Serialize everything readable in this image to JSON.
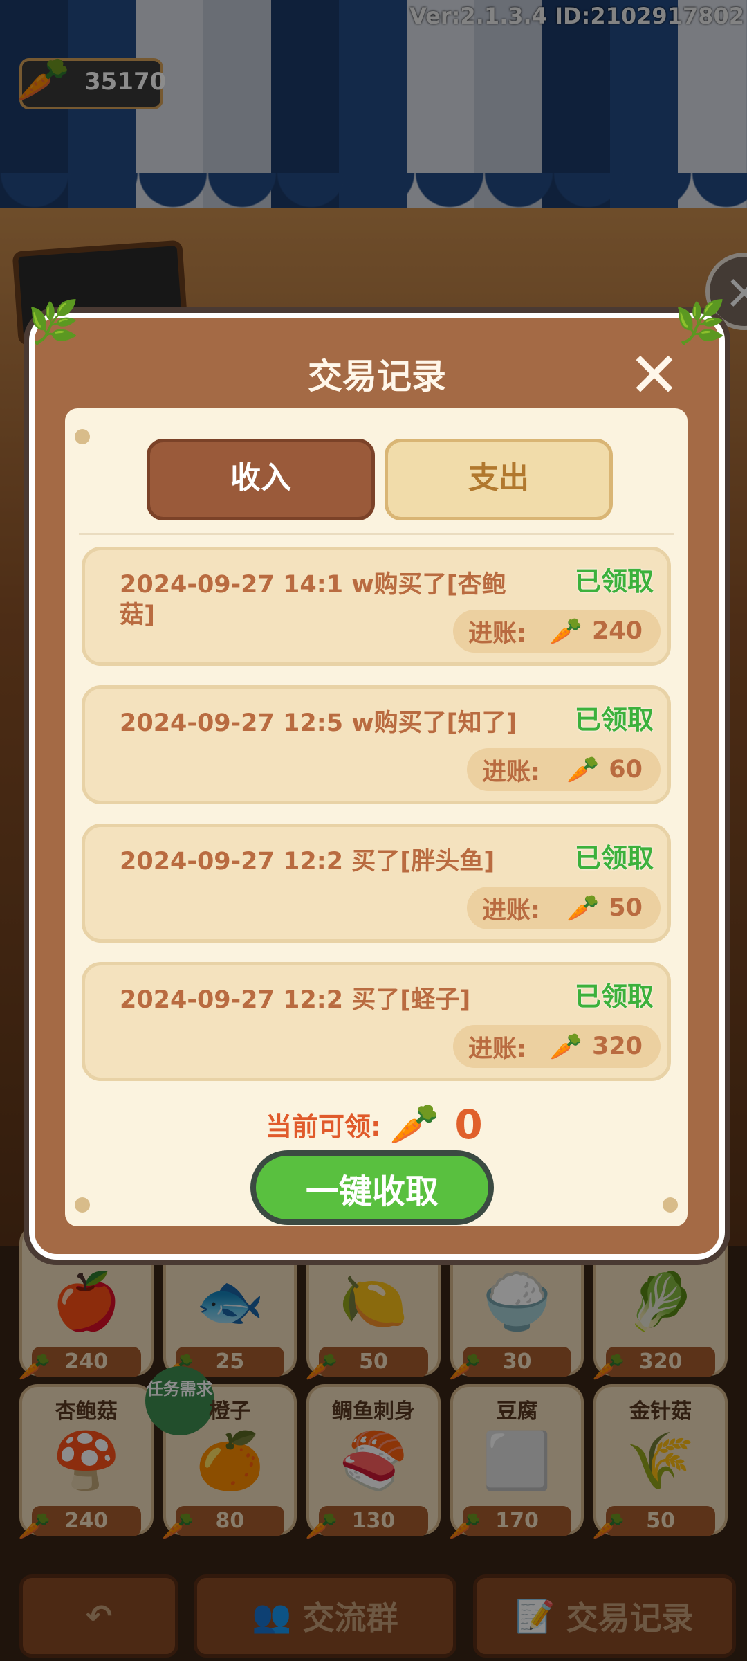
{
  "version_label": "Ver:2.1.3.4 ID:2102917802",
  "currency": {
    "amount": "35170",
    "icon": "carrot-icon"
  },
  "modal": {
    "title": "交易记录",
    "tabs": [
      {
        "label": "收入",
        "active": true
      },
      {
        "label": "支出",
        "active": false
      }
    ],
    "records": [
      {
        "text": "2024-09-27 14:1     w购买了[杏鲍菇]",
        "status": "已领取",
        "amount_label": "进账:",
        "amount": "240"
      },
      {
        "text": "2024-09-27 12:5     w购买了[知了]",
        "status": "已领取",
        "amount_label": "进账:",
        "amount": "60"
      },
      {
        "text": "2024-09-27 12:2       买了[胖头鱼]",
        "status": "已领取",
        "amount_label": "进账:",
        "amount": "50"
      },
      {
        "text": "2024-09-27 12:2        买了[蛏子]",
        "status": "已领取",
        "amount_label": "进账:",
        "amount": "320"
      }
    ],
    "claimable_label": "当前可领:",
    "claimable_value": "0",
    "collect_button": "一键收取"
  },
  "shelf_row1": [
    {
      "price": "240",
      "pic": "🍎"
    },
    {
      "price": "25",
      "pic": "🐟"
    },
    {
      "price": "50",
      "pic": "🍋"
    },
    {
      "price": "30",
      "pic": "🍚"
    },
    {
      "price": "320",
      "pic": "🥬"
    }
  ],
  "shelf_row2": [
    {
      "name": "杏鲍菇",
      "price": "240",
      "pic": "🍄"
    },
    {
      "name": "橙子",
      "price": "80",
      "pic": "🍊",
      "badge": "任务需求"
    },
    {
      "name": "鲷鱼刺身",
      "price": "130",
      "pic": "🍣"
    },
    {
      "name": "豆腐",
      "price": "170",
      "pic": "⬜"
    },
    {
      "name": "金针菇",
      "price": "50",
      "pic": "🌾"
    }
  ],
  "bottom_bar": {
    "back_icon": "back-arrow-icon",
    "group_label": "交流群",
    "records_label": "交易记录"
  },
  "colors": {
    "accent_green": "#59c03f",
    "brown": "#a46a45",
    "paper": "#fbf3df"
  }
}
